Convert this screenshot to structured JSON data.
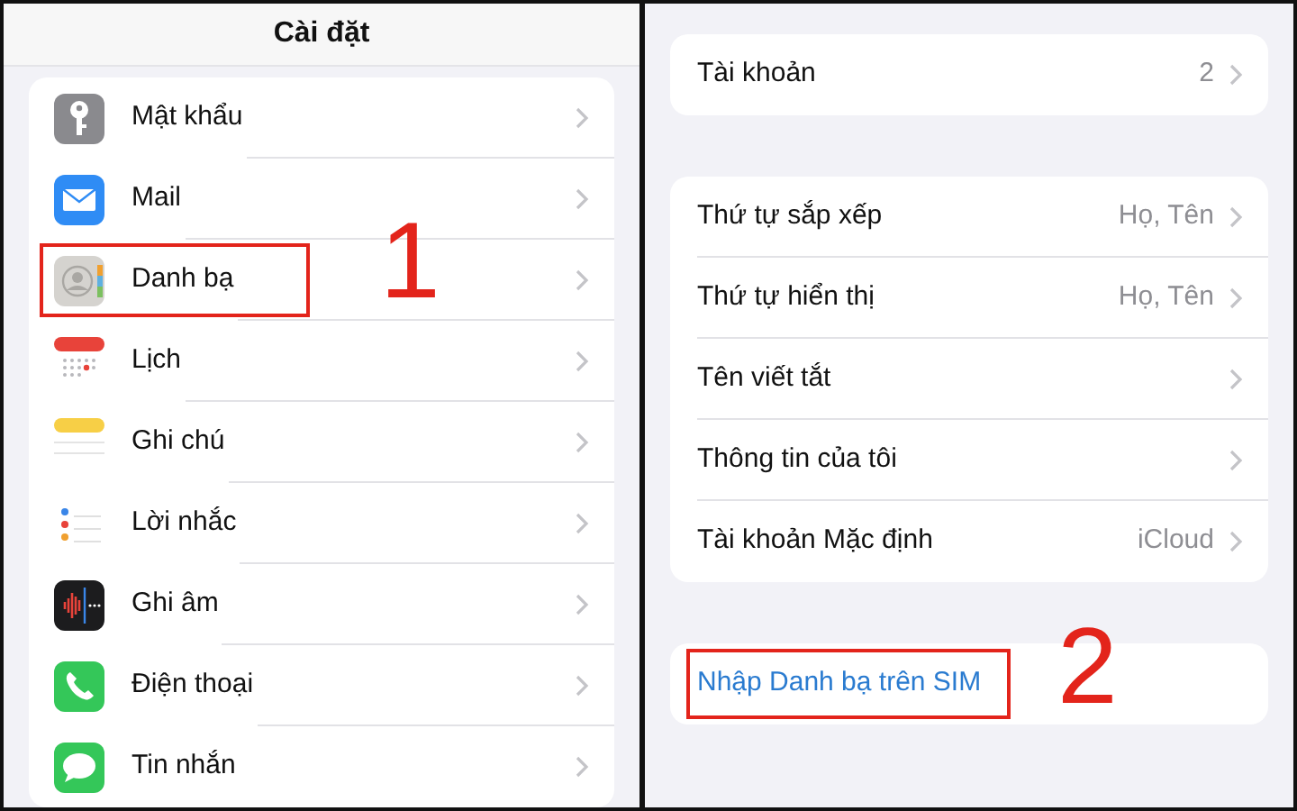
{
  "left": {
    "title": "Cài đặt",
    "items": [
      {
        "kind": "key",
        "label": "Mật khẩu",
        "highlighted": false
      },
      {
        "kind": "mail",
        "label": "Mail",
        "highlighted": false
      },
      {
        "kind": "contacts",
        "label": "Danh bạ",
        "highlighted": true,
        "step": "1"
      },
      {
        "kind": "calendar",
        "label": "Lịch",
        "highlighted": false
      },
      {
        "kind": "notes",
        "label": "Ghi chú",
        "highlighted": false
      },
      {
        "kind": "reminders",
        "label": "Lời nhắc",
        "highlighted": false
      },
      {
        "kind": "voice",
        "label": "Ghi âm",
        "highlighted": false
      },
      {
        "kind": "phone",
        "label": "Điện thoại",
        "highlighted": false
      },
      {
        "kind": "messages",
        "label": "Tin nhắn",
        "highlighted": false
      }
    ]
  },
  "right": {
    "groups": [
      {
        "rows": [
          {
            "kind": "nav",
            "label": "Tài khoản",
            "value": "2",
            "highlighted": false
          }
        ]
      },
      {
        "rows": [
          {
            "kind": "nav",
            "label": "Thứ tự sắp xếp",
            "value": "Họ, Tên",
            "highlighted": false
          },
          {
            "kind": "nav",
            "label": "Thứ tự hiển thị",
            "value": "Họ, Tên",
            "highlighted": false
          },
          {
            "kind": "nav",
            "label": "Tên viết tắt",
            "highlighted": false
          },
          {
            "kind": "nav",
            "label": "Thông tin của tôi",
            "highlighted": false
          },
          {
            "kind": "nav",
            "label": "Tài khoản Mặc định",
            "value": "iCloud",
            "highlighted": false
          }
        ]
      },
      {
        "rows": [
          {
            "kind": "link",
            "label": "Nhập Danh bạ trên SIM",
            "highlighted": true,
            "step": "2"
          }
        ]
      }
    ]
  }
}
